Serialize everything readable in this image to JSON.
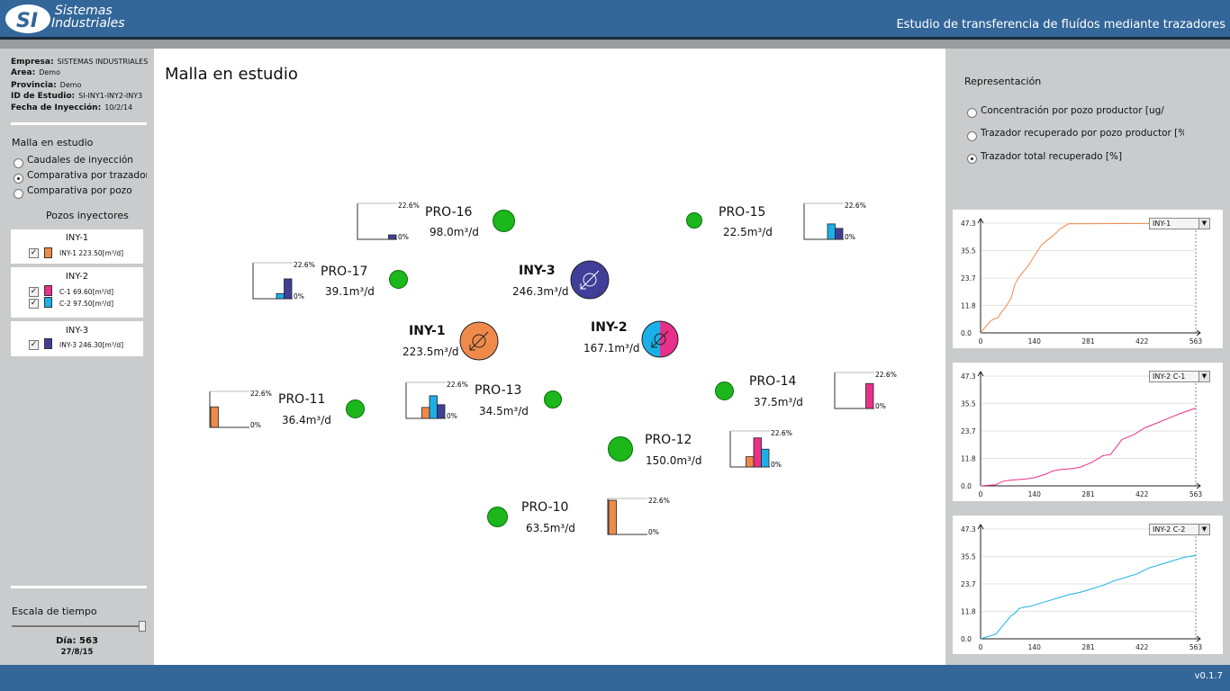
{
  "header": {
    "brand_line1": "Sistemas",
    "brand_line2": "Industriales",
    "logo_mark": "SI",
    "title": "Estudio de transferencia de fluídos mediante trazadores",
    "color": "#336699"
  },
  "footer": {
    "version": "v0.1.7"
  },
  "study_info": {
    "company_label": "Empresa:",
    "company": "SISTEMAS INDUSTRIALES",
    "area_label": "Area:",
    "area": "Demo",
    "province_label": "Provincia:",
    "province": "Demo",
    "study_id_label": "ID de Estudio:",
    "study_id": "SI-INY1-INY2-INY3",
    "injection_date_label": "Fecha de Inyección:",
    "injection_date": "10/2/14"
  },
  "view_mode": {
    "title": "Malla en estudio",
    "options": [
      {
        "label": "Caudales de inyección",
        "selected": false
      },
      {
        "label": "Comparativa por trazador",
        "selected": true
      },
      {
        "label": "Comparativa por pozo",
        "selected": false
      }
    ]
  },
  "injectors_panel": {
    "title": "Pozos inyectores",
    "groups": [
      {
        "name": "INY-1",
        "items": [
          {
            "label": "INY-1 223.50[m³/d]",
            "color": "#f08a4b",
            "checked": true
          }
        ]
      },
      {
        "name": "INY-2",
        "items": [
          {
            "label": "C-1 69.60[m³/d]",
            "color": "#e8308a",
            "checked": true
          },
          {
            "label": "C-2 97.50[m³/d]",
            "color": "#1bb0e8",
            "checked": true
          }
        ]
      },
      {
        "name": "INY-3",
        "items": [
          {
            "label": "INY-3 246.30[m³/d]",
            "color": "#3f3f99",
            "checked": true
          }
        ]
      }
    ]
  },
  "time_scale": {
    "title": "Escala de tiempo",
    "day_label": "Día: 563",
    "date": "27/8/15",
    "position_fraction": 1.0
  },
  "map": {
    "title": "Malla en estudio",
    "mini_max_label": "22.6%",
    "mini_min_label": "0%",
    "injectors": [
      {
        "name": "INY-1",
        "rate": "223.5m³/d",
        "colors": [
          "#f08a4b"
        ]
      },
      {
        "name": "INY-2",
        "rate": "167.1m³/d",
        "colors": [
          "#1bb0e8",
          "#e8308a"
        ]
      },
      {
        "name": "INY-3",
        "rate": "246.3m³/d",
        "colors": [
          "#3f3f99"
        ]
      }
    ],
    "producers": [
      {
        "name": "PRO-16",
        "rate": "98.0m³/d",
        "bars": [
          0,
          0,
          0,
          0.13
        ]
      },
      {
        "name": "PRO-15",
        "rate": "22.5m³/d",
        "bars": [
          0,
          0,
          0.45,
          0.32
        ]
      },
      {
        "name": "PRO-17",
        "rate": "39.1m³/d",
        "bars": [
          0,
          0,
          0.15,
          0.58
        ]
      },
      {
        "name": "PRO-11",
        "rate": "36.4m³/d",
        "bars": [
          0.6,
          0,
          0,
          0
        ]
      },
      {
        "name": "PRO-13",
        "rate": "34.5m³/d",
        "bars": [
          0.32,
          0,
          0.66,
          0.4
        ]
      },
      {
        "name": "PRO-14",
        "rate": "37.5m³/d",
        "bars": [
          0,
          0.73,
          0,
          0
        ]
      },
      {
        "name": "PRO-12",
        "rate": "150.0m³/d",
        "bars": [
          0.3,
          0.85,
          0.52,
          0
        ]
      },
      {
        "name": "PRO-10",
        "rate": "63.5m³/d",
        "bars": [
          1.0,
          0,
          0,
          0
        ]
      }
    ]
  },
  "representation": {
    "title": "Representación",
    "options": [
      {
        "label": "Concentración por pozo productor [ug/",
        "selected": false
      },
      {
        "label": "Trazador recuperado por pozo productor [%",
        "selected": false
      },
      {
        "label": "Trazador total recuperado [%]",
        "selected": true
      }
    ]
  },
  "charts": [
    {
      "dropdown": "INY-1",
      "color": "#f08a4b",
      "chart_data": {
        "type": "line",
        "xlim": [
          0,
          563
        ],
        "ylim": [
          0,
          47.3
        ],
        "x_ticks": [
          "0",
          "140",
          "281",
          "422",
          "563"
        ],
        "y_ticks": [
          "0.0",
          "11.8",
          "23.7",
          "35.5",
          "47.3"
        ],
        "x": [
          0,
          10,
          25,
          35,
          45,
          55,
          65,
          80,
          90,
          100,
          110,
          125,
          140,
          160,
          175,
          190,
          210,
          230,
          563
        ],
        "y": [
          0,
          2,
          5,
          6,
          6.5,
          9,
          11,
          15,
          21,
          24,
          26,
          29,
          33,
          38,
          40,
          42,
          45,
          47,
          47.3
        ]
      }
    },
    {
      "dropdown": "INY-2 C-1",
      "color": "#e8308a",
      "chart_data": {
        "type": "line",
        "xlim": [
          0,
          563
        ],
        "ylim": [
          0,
          47.3
        ],
        "x_ticks": [
          "0",
          "140",
          "281",
          "422",
          "563"
        ],
        "y_ticks": [
          "0.0",
          "11.8",
          "23.7",
          "35.5",
          "47.3"
        ],
        "x": [
          0,
          40,
          60,
          80,
          120,
          140,
          170,
          190,
          210,
          240,
          260,
          290,
          320,
          340,
          370,
          400,
          430,
          460,
          490,
          520,
          563
        ],
        "y": [
          0,
          0.5,
          2,
          2.5,
          3,
          3.5,
          5,
          6.5,
          7,
          7.5,
          8,
          10,
          13,
          13.5,
          20,
          22,
          25,
          27,
          29,
          31,
          33.5
        ]
      }
    },
    {
      "dropdown": "INY-2 C-2",
      "color": "#1bb0e8",
      "chart_data": {
        "type": "line",
        "xlim": [
          0,
          563
        ],
        "ylim": [
          0,
          47.3
        ],
        "x_ticks": [
          "0",
          "140",
          "281",
          "422",
          "563"
        ],
        "y_ticks": [
          "0.0",
          "11.8",
          "23.7",
          "35.5",
          "47.3"
        ],
        "x": [
          0,
          20,
          40,
          55,
          70,
          80,
          90,
          100,
          110,
          130,
          150,
          170,
          190,
          210,
          230,
          260,
          290,
          320,
          350,
          380,
          410,
          440,
          470,
          500,
          530,
          563
        ],
        "y": [
          0,
          1,
          2,
          5,
          8,
          10,
          11,
          13,
          13.5,
          14,
          15,
          16,
          17,
          18,
          19,
          20,
          21.5,
          23,
          25,
          26.5,
          28,
          30.5,
          32,
          33.5,
          35,
          36
        ]
      }
    }
  ]
}
